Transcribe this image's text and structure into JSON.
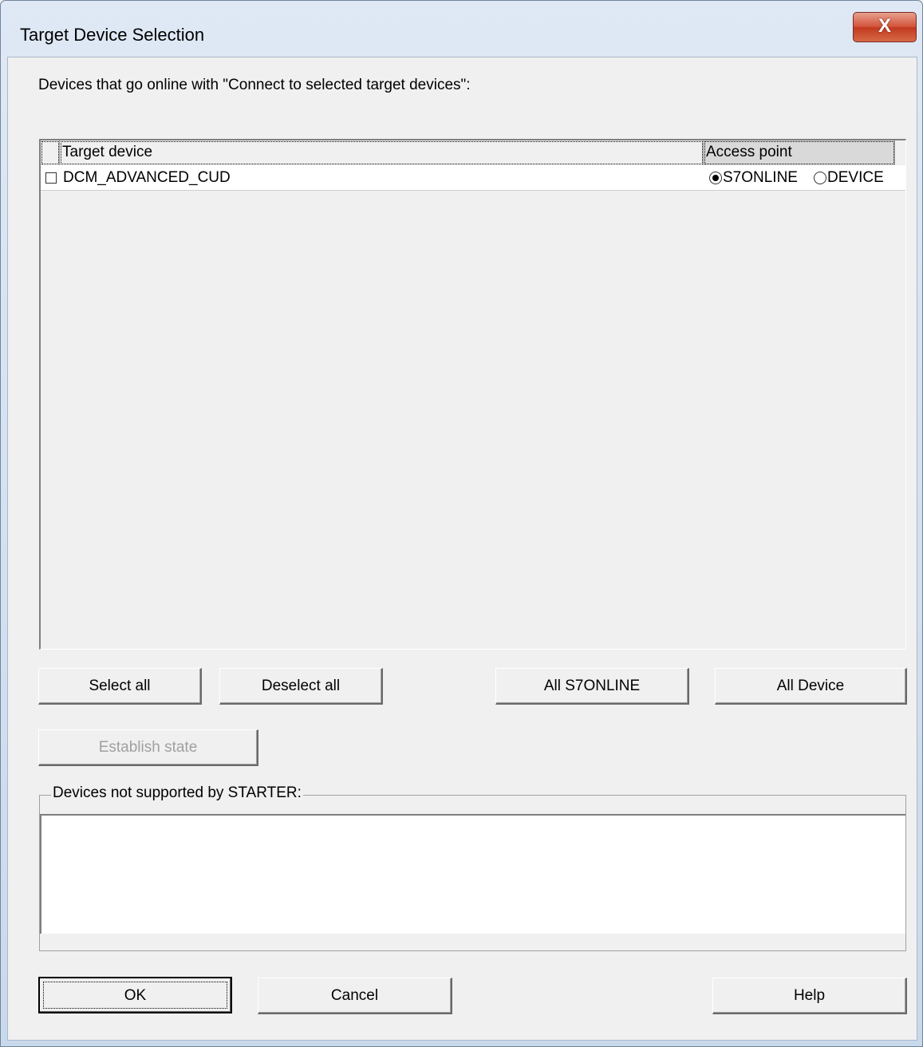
{
  "window": {
    "title": "Target Device Selection",
    "close_label": "X"
  },
  "intro_text": "Devices that go online with \"Connect to selected target devices\":",
  "device_table": {
    "columns": [
      "Target device",
      "Access point"
    ],
    "rows": [
      {
        "name": "DCM_ADVANCED_CUD",
        "checked": false,
        "access_options": [
          "S7ONLINE",
          "DEVICE"
        ],
        "selected_access": "S7ONLINE"
      }
    ]
  },
  "buttons": {
    "select_all": "Select all",
    "deselect_all": "Deselect all",
    "all_s7online": "All S7ONLINE",
    "all_device": "All Device",
    "establish_state": "Establish state",
    "ok": "OK",
    "cancel": "Cancel",
    "help": "Help"
  },
  "unsupported_group": {
    "title": "Devices not supported by STARTER:"
  },
  "colors": {
    "title_gradient_top": "#dfe9f5",
    "close_button": "#c23a20",
    "dialog_face": "#f0f0f0",
    "list_background": "#ffffff",
    "disabled_text": "#a0a0a0"
  }
}
